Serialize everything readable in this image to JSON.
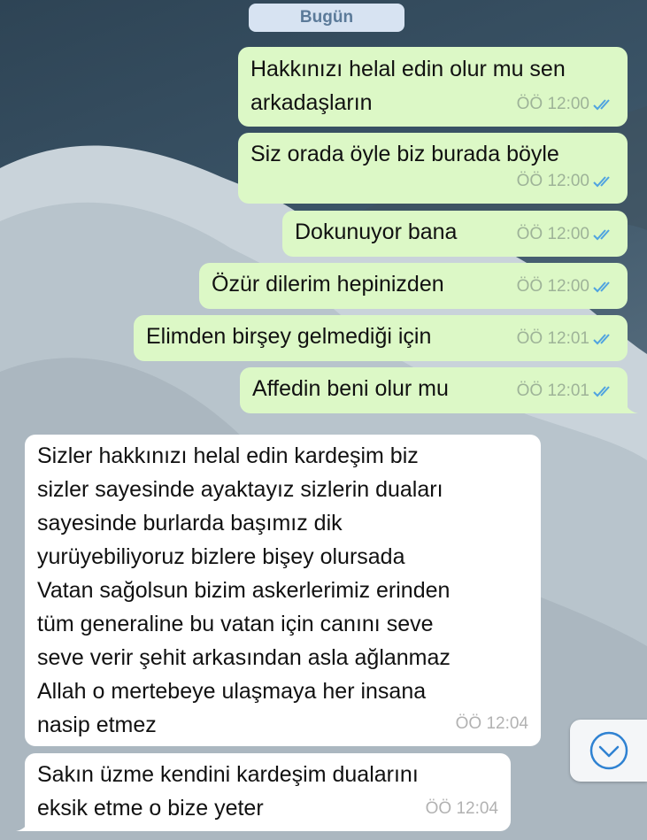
{
  "chat": {
    "day_label": "Bugün",
    "messages": [
      {
        "direction": "out",
        "text": "Hakkınızı helal edin olur mu sen\narkadaşların",
        "time": "ÖÖ 12:00",
        "status": "read"
      },
      {
        "direction": "out",
        "text": "Siz orada öyle biz burada böyle",
        "time": "ÖÖ 12:00",
        "status": "read"
      },
      {
        "direction": "out",
        "text": "Dokunuyor bana",
        "time": "ÖÖ 12:00",
        "status": "read"
      },
      {
        "direction": "out",
        "text": "Özür dilerim hepinizden",
        "time": "ÖÖ 12:00",
        "status": "read"
      },
      {
        "direction": "out",
        "text": "Elimden birşey gelmediği için",
        "time": "ÖÖ 12:01",
        "status": "read"
      },
      {
        "direction": "out",
        "text": "Affedin beni olur mu",
        "time": "ÖÖ 12:01",
        "status": "read"
      },
      {
        "direction": "in",
        "text": "Sizler hakkınızı helal edin kardeşim biz\nsizler sayesinde ayaktayız sizlerin duaları\nsayesinde burlarda başımız dik\nyurüyebiliyoruz bizlere bişey olursada\nVatan sağolsun bizim askerlerimiz erinden\ntüm generaline bu vatan için canını seve\nseve verir şehit arkasından asla ağlanmaz\nAllah o mertebeye ulaşmaya her insana\nnasip etmez",
        "time": "ÖÖ 12:04"
      },
      {
        "direction": "in",
        "text": "Sakın üzme kendini kardeşim dualarını\neksik etme o bize yeter",
        "time": "ÖÖ 12:04"
      }
    ],
    "scroll_down_icon": "chevron-down-circle-icon"
  },
  "colors": {
    "outgoing_bubble": "#dcf8c6",
    "incoming_bubble": "#ffffff",
    "read_ticks": "#4fa3e0",
    "day_badge": "#d7e3f2"
  }
}
